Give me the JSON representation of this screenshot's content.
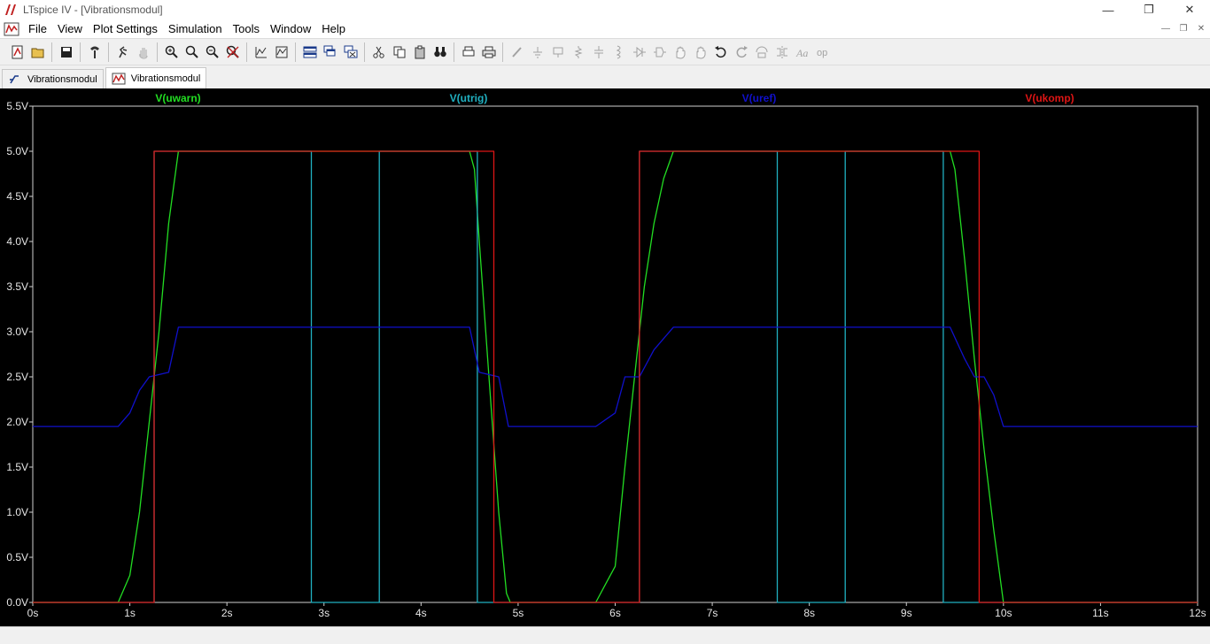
{
  "window": {
    "title": "LTspice IV - [Vibrationsmodul]",
    "controls": {
      "minimize": "—",
      "restore": "❐",
      "close": "✕"
    }
  },
  "menu": {
    "items": [
      "File",
      "View",
      "Plot Settings",
      "Simulation",
      "Tools",
      "Window",
      "Help"
    ],
    "mdi_controls": {
      "minimize": "—",
      "restore": "❐",
      "close": "✕"
    }
  },
  "toolbar": {
    "groups": [
      [
        "new-schematic-icon",
        "open-icon"
      ],
      [
        "save-icon"
      ],
      [
        "control-panel-icon"
      ],
      [
        "run-icon",
        "halt-icon"
      ],
      [
        "zoom-in-icon",
        "zoom-area-icon",
        "zoom-out-icon",
        "zoom-cancel-icon"
      ],
      [
        "autorange-icon",
        "waveform-icon"
      ],
      [
        "tile-horizontal-icon",
        "cascade-icon",
        "close-all-icon"
      ],
      [
        "cut-icon",
        "copy-icon",
        "paste-icon",
        "find-icon"
      ],
      [
        "print-preview-icon",
        "print-icon"
      ],
      [
        "wire-icon",
        "ground-icon",
        "label-net-icon",
        "resistor-icon",
        "capacitor-icon",
        "inductor-icon",
        "diode-icon",
        "component-icon",
        "move-icon",
        "drag-icon",
        "undo-icon",
        "redo-icon",
        "rotate-icon",
        "mirror-icon",
        "text-icon",
        "spice-directive-icon"
      ]
    ]
  },
  "tabs": [
    {
      "label": "Vibrationsmodul",
      "icon": "schematic-icon",
      "active": false
    },
    {
      "label": "Vibrationsmodul",
      "icon": "waveform-icon",
      "active": true
    }
  ],
  "colors": {
    "uwarn": "#22dd22",
    "utrig": "#20b0c0",
    "uref": "#1010cc",
    "ukomp": "#dd1515",
    "axis": "#cfcfcf",
    "tick_text": "#e6e6e6",
    "background": "#000000"
  },
  "chart_data": {
    "type": "line",
    "title": "",
    "xlabel": "",
    "ylabel": "",
    "xlim": [
      0,
      12
    ],
    "ylim": [
      0,
      5.5
    ],
    "x_ticks": [
      "0s",
      "1s",
      "2s",
      "3s",
      "4s",
      "5s",
      "6s",
      "7s",
      "8s",
      "9s",
      "10s",
      "11s",
      "12s"
    ],
    "y_ticks": [
      "0.0V",
      "0.5V",
      "1.0V",
      "1.5V",
      "2.0V",
      "2.5V",
      "3.0V",
      "3.5V",
      "4.0V",
      "4.5V",
      "5.0V",
      "5.5V"
    ],
    "grid": false,
    "legend_position": "top",
    "series": [
      {
        "name": "V(uwarn)",
        "color": "#22dd22",
        "points": [
          [
            0,
            0
          ],
          [
            0.88,
            0
          ],
          [
            1.0,
            0.3
          ],
          [
            1.1,
            1.0
          ],
          [
            1.2,
            2.0
          ],
          [
            1.3,
            3.0
          ],
          [
            1.4,
            4.2
          ],
          [
            1.5,
            5.0
          ],
          [
            4.5,
            5.0
          ],
          [
            4.55,
            4.8
          ],
          [
            4.6,
            4.0
          ],
          [
            4.7,
            2.5
          ],
          [
            4.8,
            1.0
          ],
          [
            4.88,
            0.1
          ],
          [
            4.92,
            0
          ],
          [
            5.8,
            0
          ],
          [
            5.9,
            0.2
          ],
          [
            6.0,
            0.4
          ],
          [
            6.1,
            1.5
          ],
          [
            6.2,
            2.5
          ],
          [
            6.3,
            3.5
          ],
          [
            6.4,
            4.2
          ],
          [
            6.5,
            4.7
          ],
          [
            6.6,
            5.0
          ],
          [
            9.45,
            5.0
          ],
          [
            9.5,
            4.8
          ],
          [
            9.6,
            3.8
          ],
          [
            9.7,
            2.7
          ],
          [
            9.8,
            1.7
          ],
          [
            9.9,
            0.8
          ],
          [
            10.0,
            0
          ],
          [
            12,
            0
          ]
        ]
      },
      {
        "name": "V(utrig)",
        "color": "#20b0c0",
        "points": [
          [
            0,
            0
          ],
          [
            1.25,
            0
          ],
          [
            1.25,
            5.0
          ],
          [
            2.87,
            5.0
          ],
          [
            2.87,
            0
          ],
          [
            3.57,
            0
          ],
          [
            3.57,
            5.0
          ],
          [
            4.58,
            5.0
          ],
          [
            4.58,
            0
          ],
          [
            6.25,
            0
          ],
          [
            6.25,
            5.0
          ],
          [
            7.67,
            5.0
          ],
          [
            7.67,
            0
          ],
          [
            8.37,
            0
          ],
          [
            8.37,
            5.0
          ],
          [
            9.38,
            5.0
          ],
          [
            9.38,
            0
          ],
          [
            12,
            0
          ]
        ]
      },
      {
        "name": "V(uref)",
        "color": "#1010cc",
        "points": [
          [
            0,
            1.95
          ],
          [
            0.88,
            1.95
          ],
          [
            1.0,
            2.1
          ],
          [
            1.1,
            2.35
          ],
          [
            1.2,
            2.5
          ],
          [
            1.4,
            2.55
          ],
          [
            1.5,
            3.05
          ],
          [
            4.5,
            3.05
          ],
          [
            4.6,
            2.55
          ],
          [
            4.8,
            2.5
          ],
          [
            4.9,
            1.95
          ],
          [
            5.8,
            1.95
          ],
          [
            6.0,
            2.1
          ],
          [
            6.1,
            2.5
          ],
          [
            6.25,
            2.5
          ],
          [
            6.4,
            2.8
          ],
          [
            6.6,
            3.05
          ],
          [
            9.45,
            3.05
          ],
          [
            9.6,
            2.7
          ],
          [
            9.7,
            2.5
          ],
          [
            9.8,
            2.5
          ],
          [
            9.9,
            2.3
          ],
          [
            10.0,
            1.95
          ],
          [
            12,
            1.95
          ]
        ]
      },
      {
        "name": "V(ukomp)",
        "color": "#dd1515",
        "points": [
          [
            0,
            0
          ],
          [
            1.25,
            0
          ],
          [
            1.25,
            5.0
          ],
          [
            4.75,
            5.0
          ],
          [
            4.75,
            0
          ],
          [
            6.25,
            0
          ],
          [
            6.25,
            5.0
          ],
          [
            9.75,
            5.0
          ],
          [
            9.75,
            0
          ],
          [
            12,
            0
          ]
        ]
      }
    ]
  }
}
